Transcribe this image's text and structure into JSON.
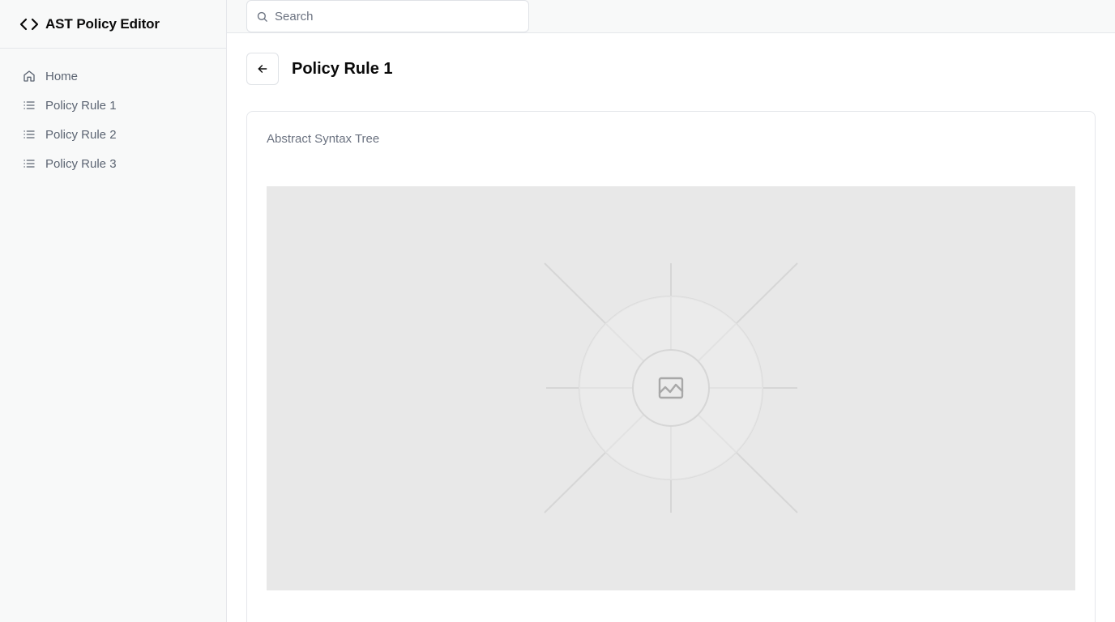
{
  "app": {
    "title": "AST Policy Editor",
    "icon": "code-brackets-icon"
  },
  "sidebar": {
    "items": [
      {
        "label": "Home",
        "icon": "home-icon"
      },
      {
        "label": "Policy Rule 1",
        "icon": "list-icon"
      },
      {
        "label": "Policy Rule 2",
        "icon": "list-icon"
      },
      {
        "label": "Policy Rule 3",
        "icon": "list-icon"
      }
    ]
  },
  "topbar": {
    "search": {
      "placeholder": "Search",
      "value": "",
      "icon": "search-icon"
    }
  },
  "page": {
    "back_icon": "arrow-left-icon",
    "title": "Policy Rule 1"
  },
  "card": {
    "label": "Abstract Syntax Tree",
    "image_icon": "image-placeholder-icon"
  },
  "colors": {
    "sidebar_bg": "#f8f9f9",
    "border": "#e5e7eb",
    "muted_text": "#6b7280",
    "placeholder_bg": "#e8e8e8"
  }
}
